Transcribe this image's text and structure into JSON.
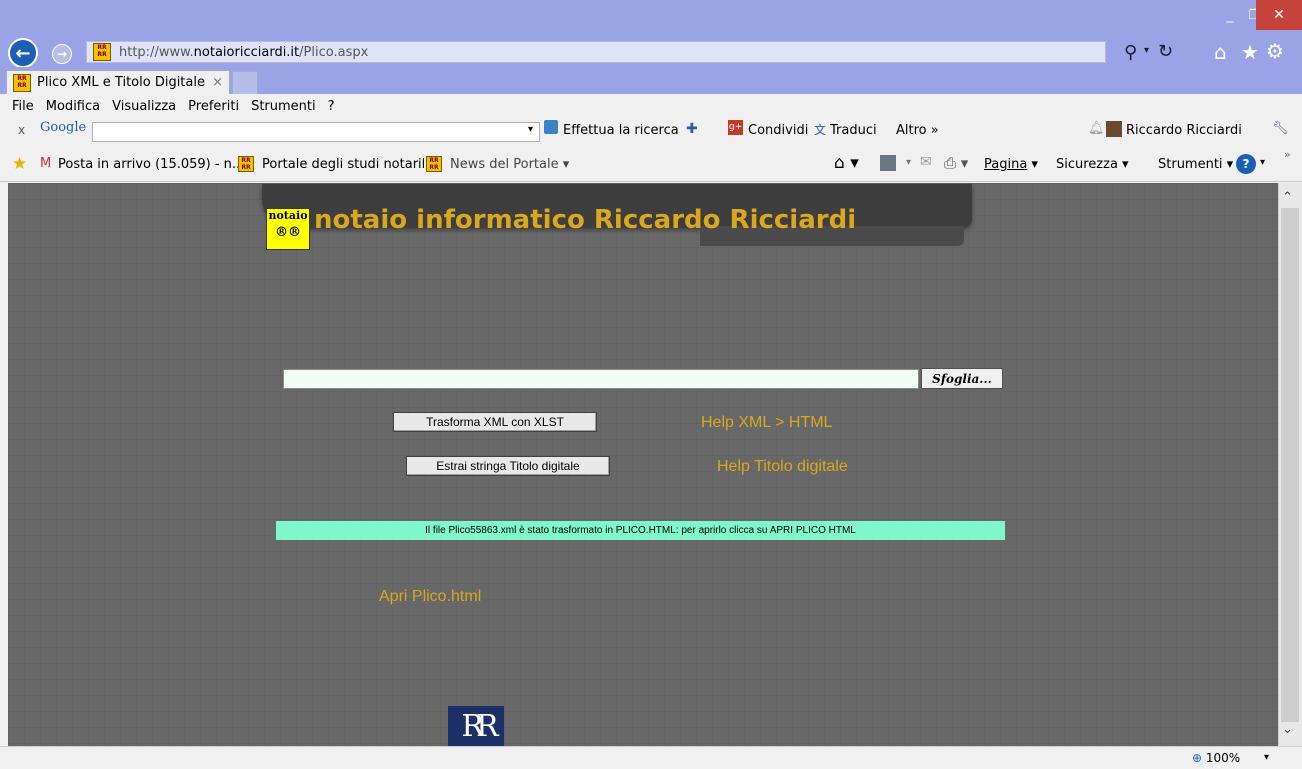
{
  "browser": {
    "url_prefix": "http://www.",
    "url_domain": "notaioricciardi.it",
    "url_path": "/Plico.aspx",
    "tab_title": "Plico XML e Titolo Digitale",
    "tab_close": "×",
    "menu": [
      "File",
      "Modifica",
      "Visualizza",
      "Preferiti",
      "Strumenti",
      "?"
    ],
    "google_toolbar": {
      "close": "x",
      "brand": "Google",
      "search_button": "Effettua la ricerca",
      "share": "Condividi",
      "translate": "Traduci",
      "more": "Altro »",
      "user": "Riccardo Ricciardi"
    },
    "favorites": {
      "inbox": "Posta in arrivo (15.059) - n...",
      "portal": "Portale degli studi notarili",
      "news": "News del Portale"
    },
    "command_bar": {
      "page": "Pagina",
      "security": "Sicurezza",
      "tools": "Strumenti"
    },
    "zoom": "100%"
  },
  "page": {
    "logo_top": "notaio",
    "logo_bottom": "®®",
    "title": "notaio informatico Riccardo Ricciardi",
    "browse_label": "Sfoglia...",
    "transform_button": "Trasforma XML con XLST",
    "help_xml": "Help XML > HTML",
    "extract_button": "Estrai stringa Titolo digitale",
    "help_titolo": "Help Titolo digitale",
    "message": "Il file Plico55863.xml è stato trasformato in PLICO.HTML: per aprirlo clicca su APRI PLICO HTML",
    "open_link": "Apri Plico.html",
    "footer_logo": "RR"
  },
  "colors": {
    "chrome": "#9aa3e6",
    "page_bg": "#686868",
    "gold": "#d9a81e",
    "message_bg": "#7ff7c9"
  }
}
